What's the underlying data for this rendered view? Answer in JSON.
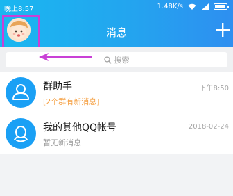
{
  "status_bar": {
    "time": "晚上8:57",
    "speed": "1.48K/s"
  },
  "header": {
    "title": "消息"
  },
  "search": {
    "placeholder": "搜索"
  },
  "conversations": [
    {
      "title": "群助手",
      "subtitle": "[2个群有新消息]",
      "time": "下午8:50",
      "icon": "group-assistant-icon"
    },
    {
      "title": "我的其他QQ帐号",
      "subtitle": "暂无新消息",
      "time": "2018-02-24",
      "icon": "other-qq-account-icon"
    }
  ],
  "colors": {
    "header_start": "#1ab7f0",
    "header_end": "#2e8ff0",
    "annotation": "#c940d6",
    "highlight_text": "#f5a043"
  }
}
